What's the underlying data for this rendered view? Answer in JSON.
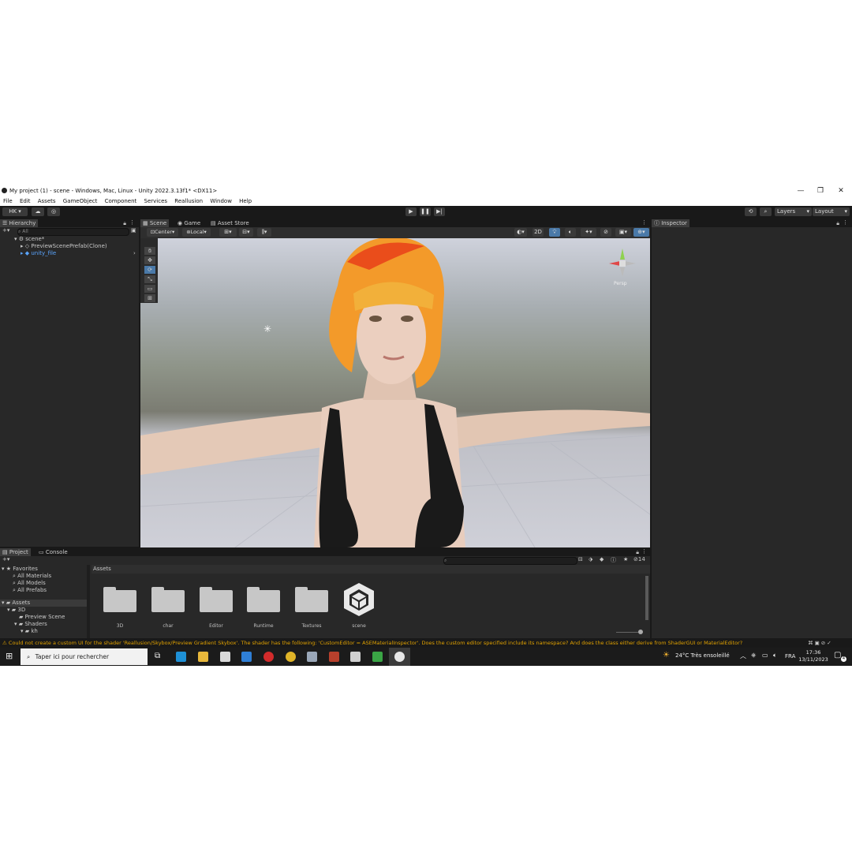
{
  "window": {
    "title": "My project (1) - scene - Windows, Mac, Linux - Unity 2022.3.13f1* <DX11>",
    "minimize": "—",
    "maximize": "❐",
    "close": "✕"
  },
  "menu": [
    "File",
    "Edit",
    "Assets",
    "GameObject",
    "Component",
    "Services",
    "Reallusion",
    "Window",
    "Help"
  ],
  "toolbar": {
    "account": "HK",
    "layers": "Layers",
    "layout": "Layout",
    "play_icon": "play-icon",
    "pause_icon": "pause-icon",
    "step_icon": "step-icon"
  },
  "hierarchy": {
    "tab": "Hierarchy",
    "search_placeholder": "All",
    "items": [
      "scene*",
      "PreviewScenePrefab(Clone)",
      "unity_file"
    ]
  },
  "scene_tabs": [
    "Scene",
    "Game",
    "Asset Store"
  ],
  "scene_toolbar": {
    "pivot": "Center",
    "space": "Local",
    "mode_2d": "2D"
  },
  "gizmo": {
    "projection": "Persp"
  },
  "inspector": {
    "tab": "Inspector"
  },
  "project": {
    "tabs": [
      "Project",
      "Console"
    ],
    "favorites_label": "Favorites",
    "favorites": [
      "All Materials",
      "All Models",
      "All Prefabs"
    ],
    "assets_label": "Assets",
    "tree": [
      "3D",
      "Preview Scene",
      "Shaders",
      "kh"
    ],
    "breadcrumb": "Assets",
    "hidden_count": "14",
    "folders": [
      "3D",
      "char",
      "Editor",
      "Runtime",
      "Textures",
      "scene"
    ]
  },
  "status": {
    "message": "Could not create a custom UI for the shader 'Reallusion/Skybox/Preview Gradient Skybox'. The shader has the following: 'CustomEditor = ASEMaterialInspector'. Does the custom editor specified include its namespace? And does the class either derive from ShaderGUI or MaterialEditor?"
  },
  "taskbar": {
    "search_placeholder": "Taper ici pour rechercher",
    "weather": "24°C  Très ensoleillé",
    "language": "FRA",
    "time": "17:36",
    "date": "13/11/2023",
    "notifications": "4"
  },
  "colors": {
    "editor_bg": "#191919",
    "panel_bg": "#282828",
    "warning": "#e0a100",
    "link": "#5aa5ff"
  }
}
